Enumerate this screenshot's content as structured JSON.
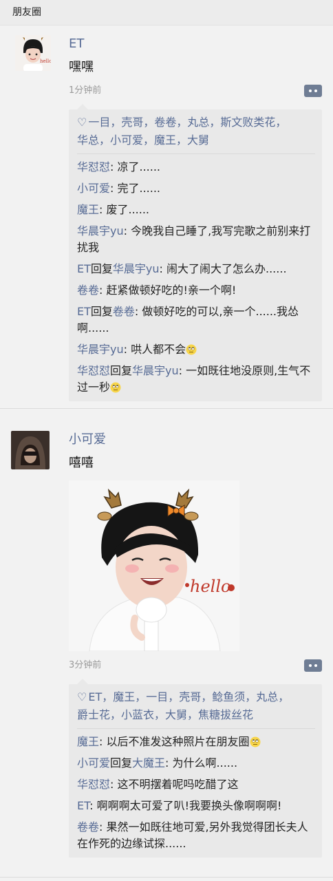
{
  "header": {
    "title": "朋友圈"
  },
  "posts": [
    {
      "author": "ET",
      "text": "嘿嘿",
      "time": "1分钟前",
      "likes": [
        "一目，壳哥，卷卷，丸总，斯文败类花，",
        "华总，小可爱，魔王，大舅"
      ],
      "comments": [
        {
          "user": "华怼怼",
          "reply_to": "",
          "text": ": 凉了......"
        },
        {
          "user": "小可爱",
          "reply_to": "",
          "text": ": 完了......"
        },
        {
          "user": "魔王",
          "reply_to": "",
          "text": ": 废了......"
        },
        {
          "user": "华晨宇yu",
          "reply_to": "",
          "text": ": 今晚我自己睡了,我写完歌之前别来打扰我"
        },
        {
          "user": "ET",
          "reply_to": "华晨宇yu",
          "text": ": 闹大了闹大了怎么办......"
        },
        {
          "user": "卷卷",
          "reply_to": "",
          "text": ": 赶紧做顿好吃的!亲一个啊!"
        },
        {
          "user": "ET",
          "reply_to": "卷卷",
          "text": ": 做顿好吃的可以,亲一个......我怂啊......"
        },
        {
          "user": "华晨宇yu",
          "reply_to": "",
          "text": ": 哄人都不会"
        },
        {
          "user": "华怼怼",
          "reply_to": "华晨宇yu",
          "text": ": 一如既往地没原则,生气不过一秒"
        }
      ]
    },
    {
      "author": "小可爱",
      "text": "嘻嘻",
      "time": "3分钟前",
      "photo_caption": "hello",
      "likes": [
        "ET，魔王，一目，壳哥，鲶鱼须，丸总，",
        "爵士花，小蓝衣，大舅，焦糖拔丝花"
      ],
      "comments": [
        {
          "user": "魔王",
          "reply_to": "",
          "text": ": 以后不准发这种照片在朋友圈"
        },
        {
          "user": "小可爱",
          "reply_to": "大魔王",
          "text": ": 为什么啊......"
        },
        {
          "user": "华怼怼",
          "reply_to": "",
          "text": ": 这不明摆着呢吗吃醋了这"
        },
        {
          "user": "ET",
          "reply_to": "",
          "text": ": 啊啊啊太可爱了叭!我要换头像啊啊啊!"
        },
        {
          "user": "卷卷",
          "reply_to": "",
          "text": ": 果然一如既往地可爱,另外我觉得团长夫人在作死的边缘试探......"
        }
      ]
    }
  ],
  "ui": {
    "reply_word": "回复",
    "heart": "♡"
  }
}
